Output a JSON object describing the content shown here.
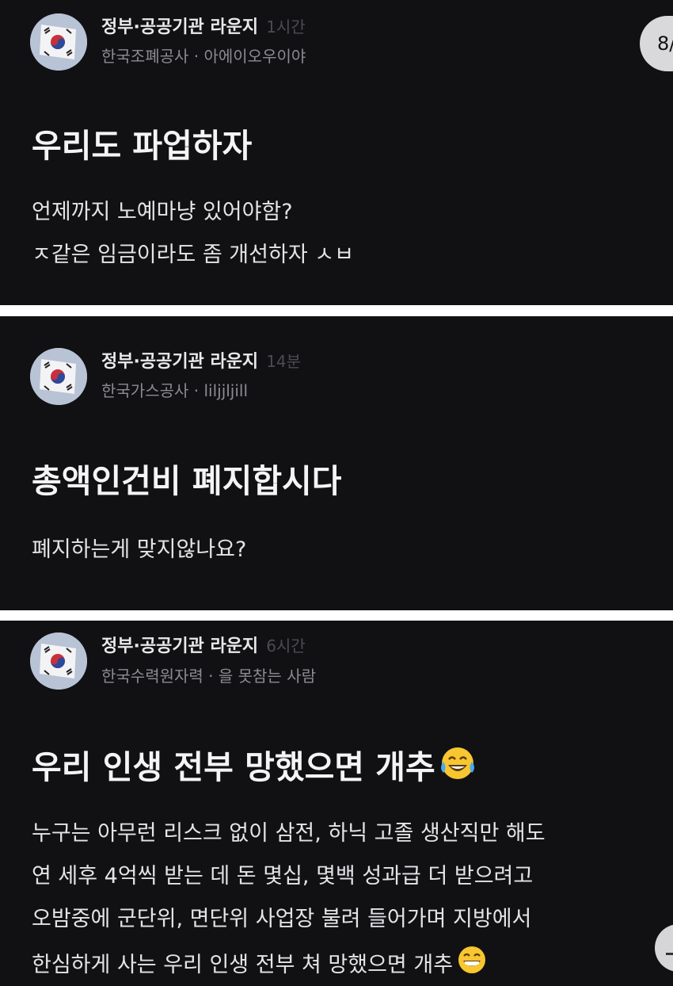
{
  "page_indicator": "8/",
  "posts": [
    {
      "lounge": "정부·공공기관 라운지",
      "time": "1시간",
      "company": "한국조폐공사 · 아에이오우이야",
      "title": "우리도 파업하자",
      "body": [
        "언제까지 노예마냥 있어야함?",
        "ㅈ같은 임금이라도 좀 개선하자 ㅅㅂ"
      ],
      "title_emoji": "",
      "body_emoji": ""
    },
    {
      "lounge": "정부·공공기관 라운지",
      "time": "14분",
      "company": "한국가스공사 · liljjljill",
      "title": "총액인건비 폐지합시다",
      "body": [
        "폐지하는게 맞지않나요?"
      ],
      "title_emoji": "",
      "body_emoji": ""
    },
    {
      "lounge": "정부·공공기관 라운지",
      "time": "6시간",
      "company": "한국수력원자력 · 을 못참는 사람",
      "title": "우리 인생 전부 망했으면 개추",
      "body": [
        "누구는 아무런 리스크 없이 삼전, 하닉 고졸 생산직만 해도",
        "연 세후 4억씩 받는 데 돈 몇십, 몇백 성과급 더 받으려고",
        "오밤중에 군단위, 면단위 사업장 불려 들어가며 지방에서",
        "한심하게 사는 우리 인생 전부 쳐 망했으면 개추"
      ],
      "title_emoji": "tears-of-joy-emoji",
      "body_emoji": "grinning-emoji"
    }
  ],
  "colors": {
    "post_background": "#111114",
    "separator": "#ffffff",
    "title_text": "#f4f4f6",
    "meta_text": "#8b8b92",
    "time_text": "#4b4b52"
  }
}
